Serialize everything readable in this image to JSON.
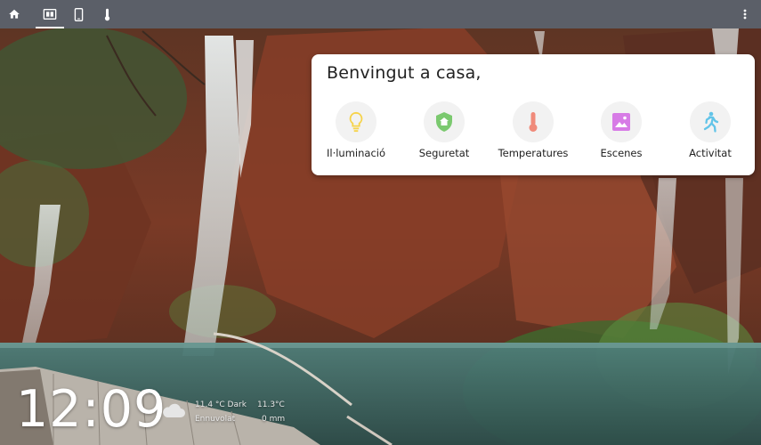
{
  "topbar": {
    "tabs": [
      {
        "icon": "home-icon"
      },
      {
        "icon": "display-icon"
      },
      {
        "icon": "tablet-icon"
      },
      {
        "icon": "thermometer-icon"
      }
    ],
    "menu_icon": "more-vertical-icon",
    "bar_color": "#5b5f68"
  },
  "welcome": {
    "title": "Benvingut a casa,",
    "tiles": [
      {
        "label": "Il·luminació",
        "icon": "lightbulb-icon",
        "color": "#f6d34a"
      },
      {
        "label": "Seguretat",
        "icon": "shield-home-icon",
        "color": "#7bc96f"
      },
      {
        "label": "Temperatures",
        "icon": "thermometer-icon",
        "color": "#f08a7a"
      },
      {
        "label": "Escenes",
        "icon": "image-icon",
        "color": "#d77be6"
      },
      {
        "label": "Activitat",
        "icon": "walking-person-icon",
        "color": "#62c4e8"
      }
    ]
  },
  "clock": {
    "time": "12:09"
  },
  "weather": {
    "icon": "cloud-icon",
    "temp": "11.4 °C Dark",
    "condition": "Ennuvolat",
    "temp2": "11.3°C",
    "precip": "0 mm"
  }
}
